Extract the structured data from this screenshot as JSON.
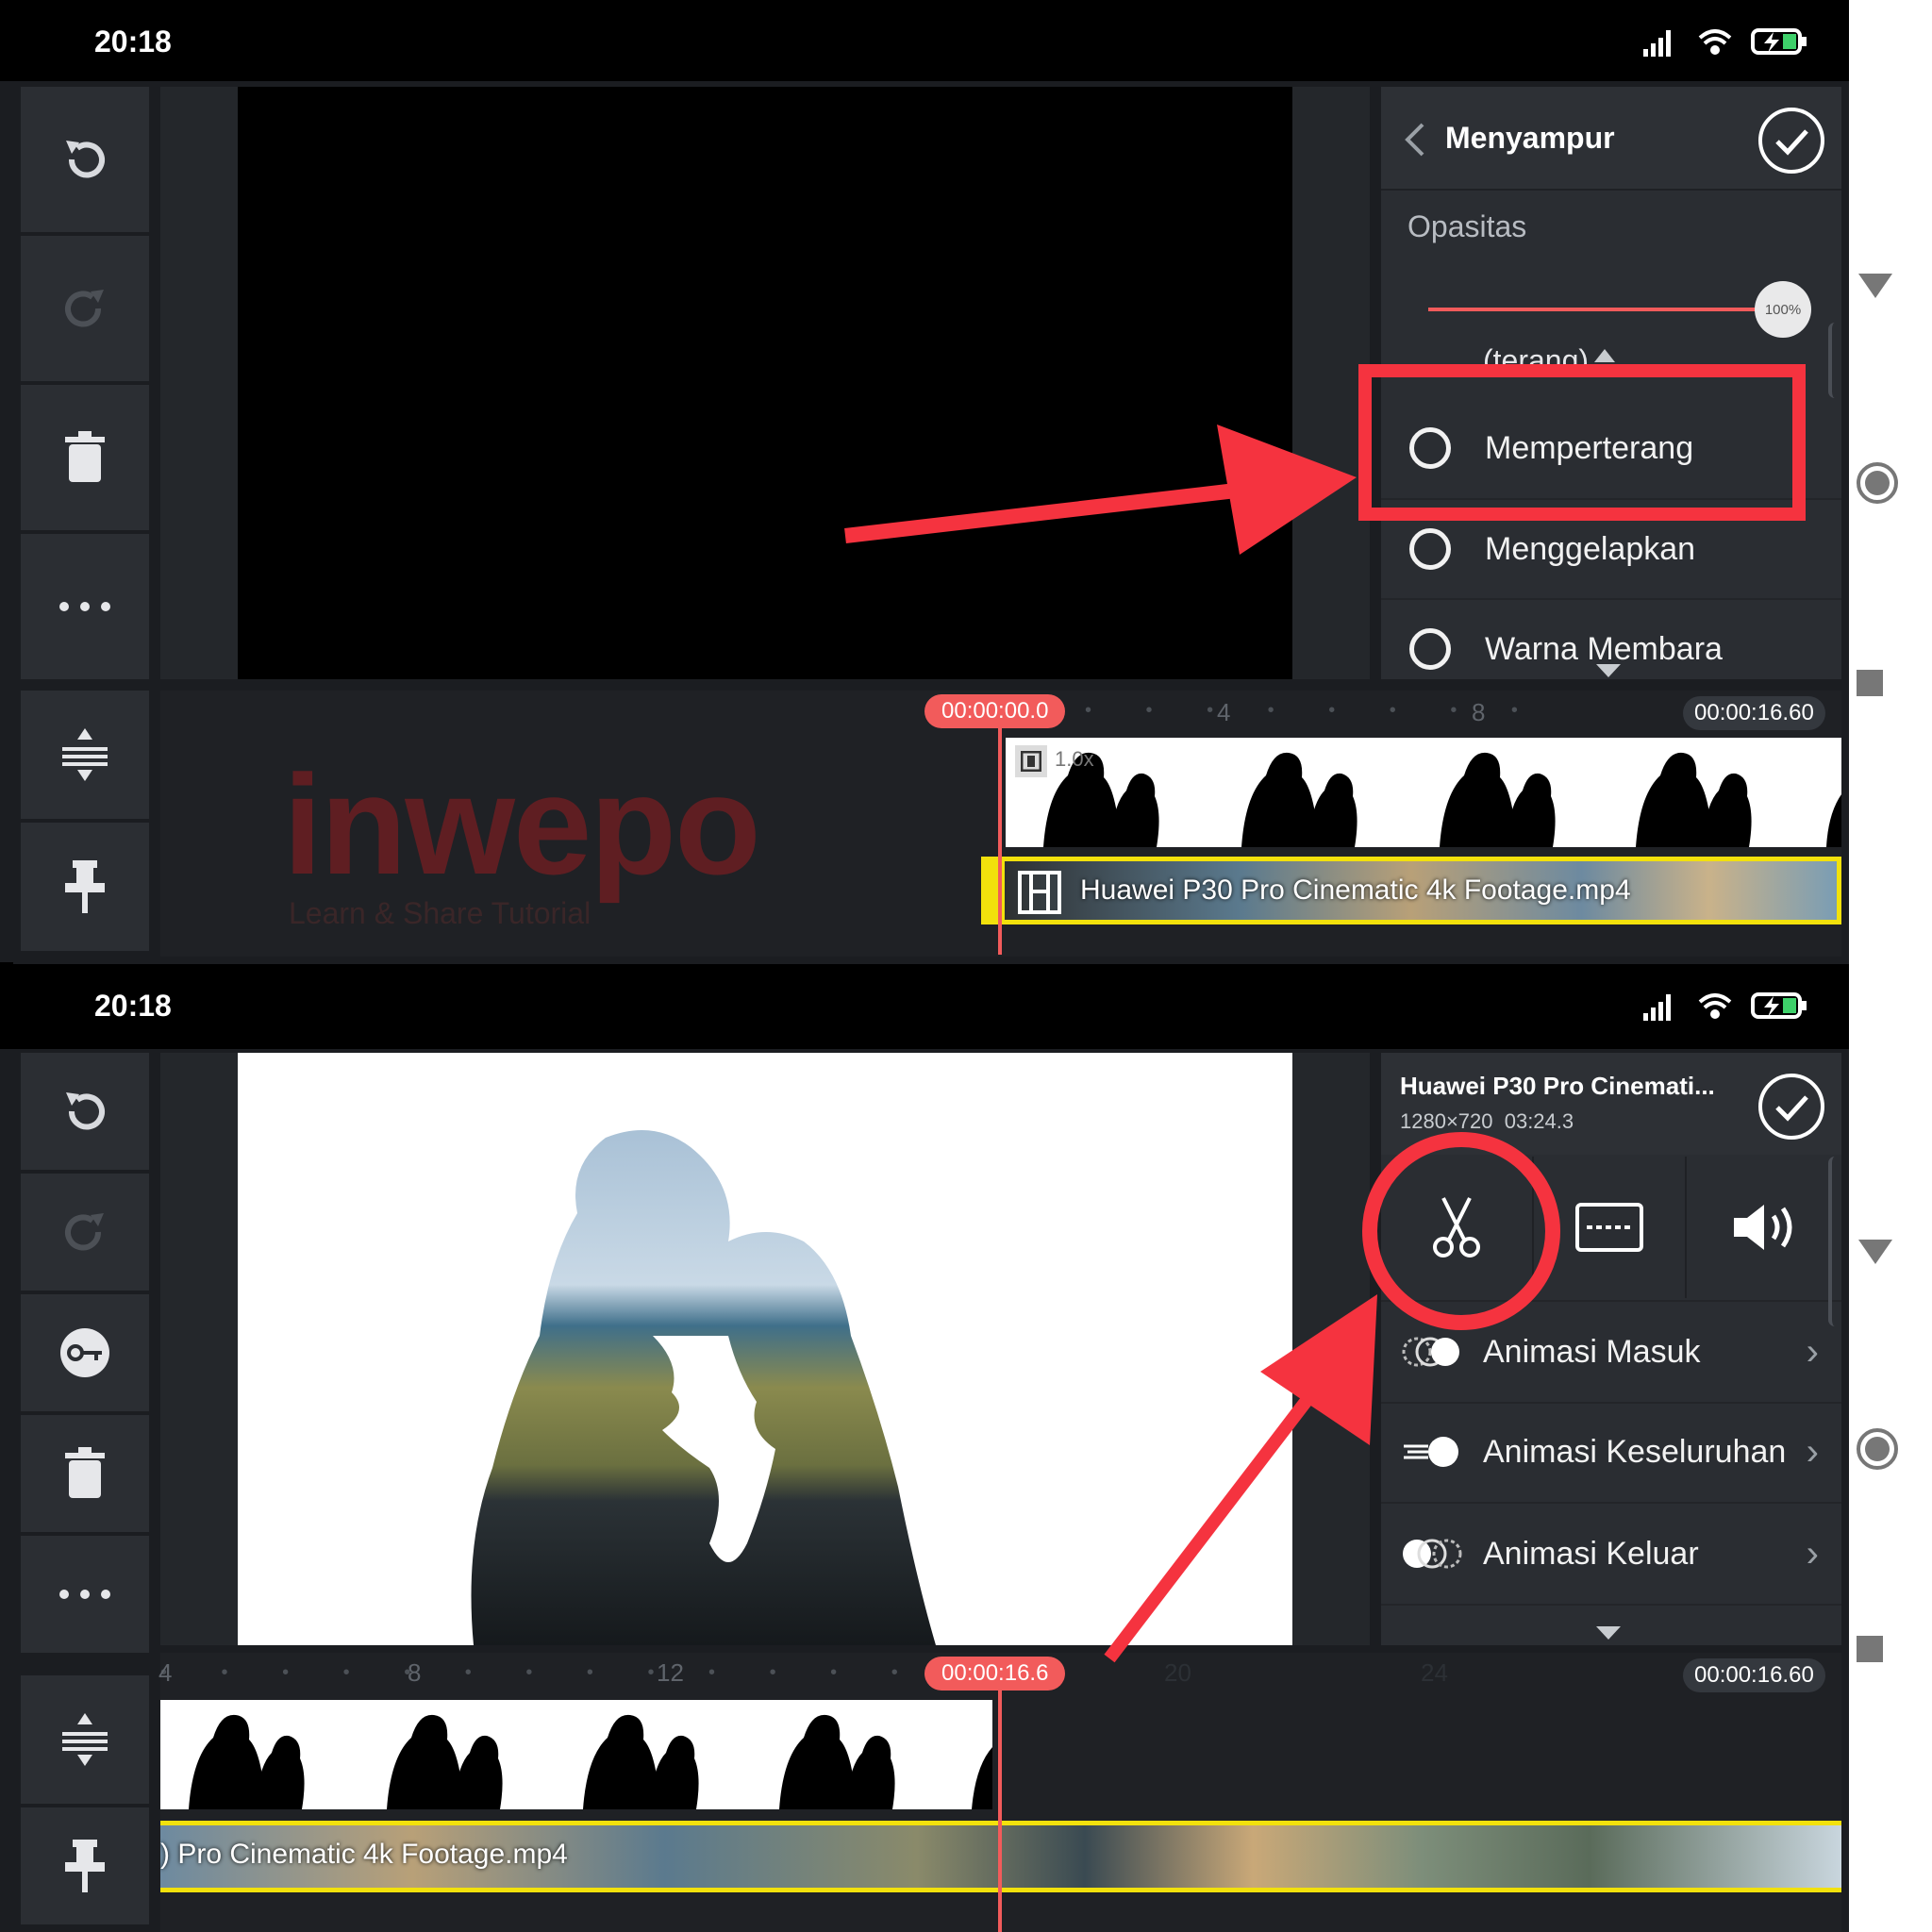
{
  "watermark": {
    "brand": "inwepo",
    "tagline": "Learn & Share Tutorial"
  },
  "top": {
    "status": {
      "time": "20:18"
    },
    "panel": {
      "title": "Menyampur",
      "opacity_label": "Opasitas",
      "opacity_value": "100%",
      "opacity_fraction": 1.0,
      "partial_item": "(terang)",
      "items": [
        "Memperterang",
        "Menggelapkan",
        "Warna Membara"
      ]
    },
    "timeline": {
      "playhead": "00:00:00.0",
      "ruler_ticks": [
        "4",
        "8"
      ],
      "end_time": "00:00:16.60",
      "layer_speed": "1.0x",
      "main_clip_name": "Huawei P30 Pro Cinematic 4k Footage.mp4"
    }
  },
  "bottom": {
    "status": {
      "time": "20:18"
    },
    "panel": {
      "clip_title": "Huawei P30 Pro Cinemati...",
      "clip_meta": "1280×720  03:24.3",
      "tools": [
        "scissors-icon",
        "subtitle-icon",
        "volume-icon"
      ],
      "items": [
        "Animasi Masuk",
        "Animasi Keseluruhan",
        "Animasi Keluar"
      ]
    },
    "timeline": {
      "playhead": "00:00:16.6",
      "ruler_ticks": [
        "4",
        "8",
        "12",
        "20",
        "24"
      ],
      "end_time": "00:00:16.60",
      "main_clip_name": ") Pro Cinematic 4k Footage.mp4"
    }
  },
  "colors": {
    "accent": "#f25b5b",
    "highlight_red": "#f5333f",
    "clip_border": "#f2e10c",
    "panel_bg": "#2a2d32"
  }
}
